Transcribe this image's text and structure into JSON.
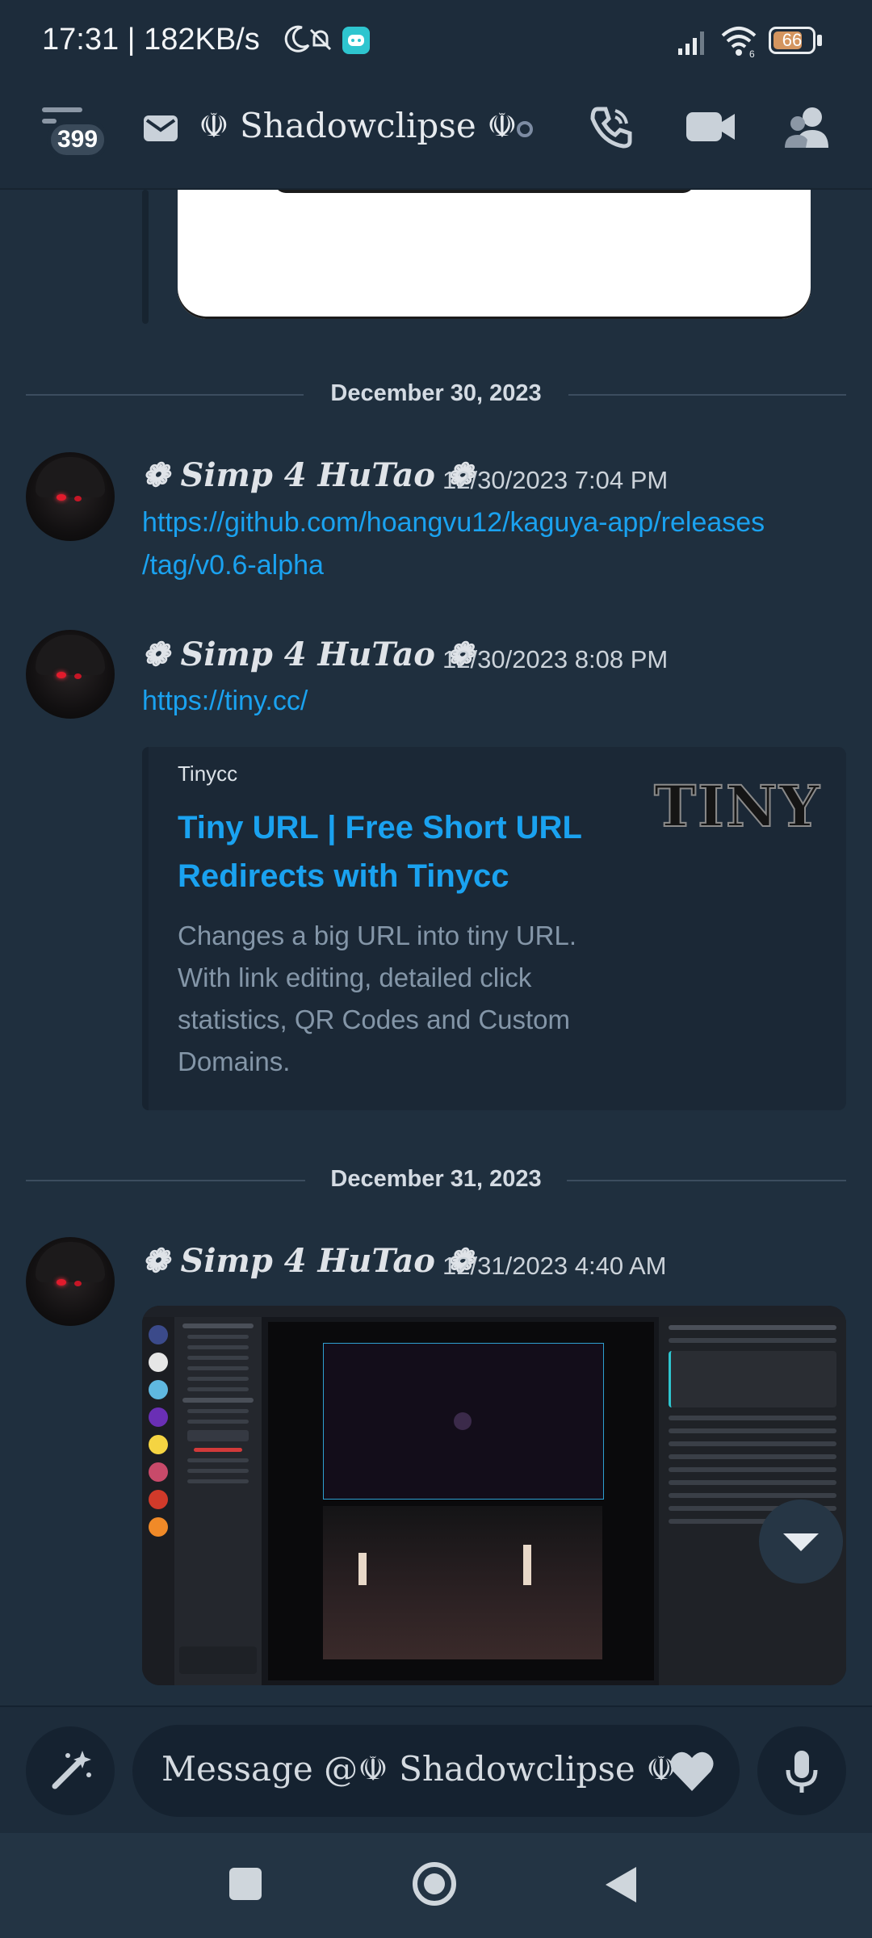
{
  "status_bar": {
    "time": "17:31 | 182KB/s",
    "battery_level": "66",
    "network": "6"
  },
  "header": {
    "notification_count": "399",
    "channel_name": "☫ Shadowclipse ☫",
    "icons": [
      "menu-icon",
      "mail-icon",
      "call-icon",
      "video-icon",
      "members-icon"
    ]
  },
  "chat": {
    "dividers": [
      {
        "label": "December 30, 2023"
      },
      {
        "label": "December 31, 2023"
      }
    ],
    "messages": [
      {
        "username": "❁ Simp 4 HuTao ❁",
        "timestamp": "12/30/2023 7:04 PM",
        "link_line1": "https://github.com/hoangvu12/kaguya-app/releases",
        "link_line2": "/tag/v0.6-alpha"
      },
      {
        "username": "❁ Simp 4 HuTao ❁",
        "timestamp": "12/30/2023 8:08 PM",
        "link": "https://tiny.cc/",
        "embed": {
          "provider": "Tinycc",
          "title": "Tiny URL | Free Short URL Redirects with Tinycc",
          "description": "Changes a big URL into tiny URL. With link editing, detailed click statistics, QR Codes and Custom Domains.",
          "logo_text": "TINY"
        }
      },
      {
        "username": "❁ Simp 4 HuTao ❁",
        "timestamp": "12/31/2023 4:40 AM",
        "attachment": "screenshot-image"
      }
    ]
  },
  "composer": {
    "placeholder": "Message @☫ Shadowclipse ☫"
  },
  "colors": {
    "background": "#1f2f3e",
    "link": "#1aa2f0",
    "accent_teal": "#2ec5cf"
  }
}
